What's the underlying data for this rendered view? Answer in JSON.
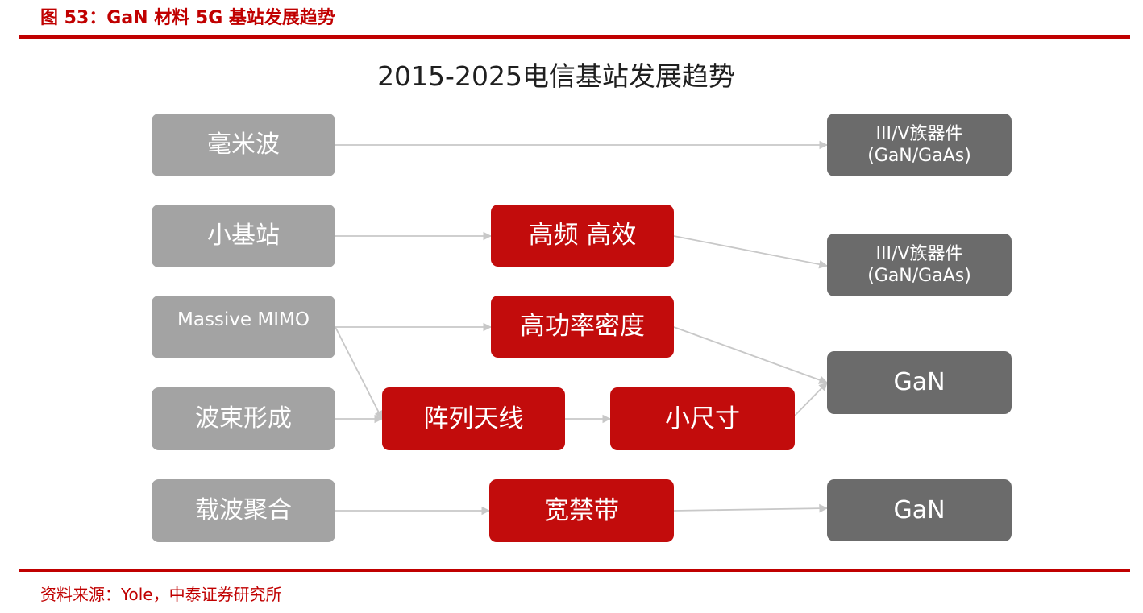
{
  "figure_title": "图 53：GaN 材料 5G 基站发展趋势",
  "diagram_title": "2015-2025电信基站发展趋势",
  "nodes": {
    "mmwave": "毫米波",
    "small_cell": "小基站",
    "massive_mimo": "Massive MIMO",
    "beamforming": "波束形成",
    "carrier_aggregation": "载波聚合",
    "high_freq_eff": "高频  高效",
    "high_power_density": "高功率密度",
    "array_antenna": "阵列天线",
    "small_size": "小尺寸",
    "wide_bandgap": "宽禁带",
    "iiiv_1": "III/V族器件\n(GaN/GaAs)",
    "iiiv_2": "III/V族器件\n(GaN/GaAs)",
    "gan_1": "GaN",
    "gan_2": "GaN"
  },
  "colors": {
    "brand_red": "#c00000",
    "node_red": "#c20c0c",
    "node_light_gray": "#a3a3a3",
    "node_dark_gray": "#6b6b6b",
    "arrow": "#c8c8c8"
  },
  "source": "资料来源：Yole，中泰证券研究所"
}
